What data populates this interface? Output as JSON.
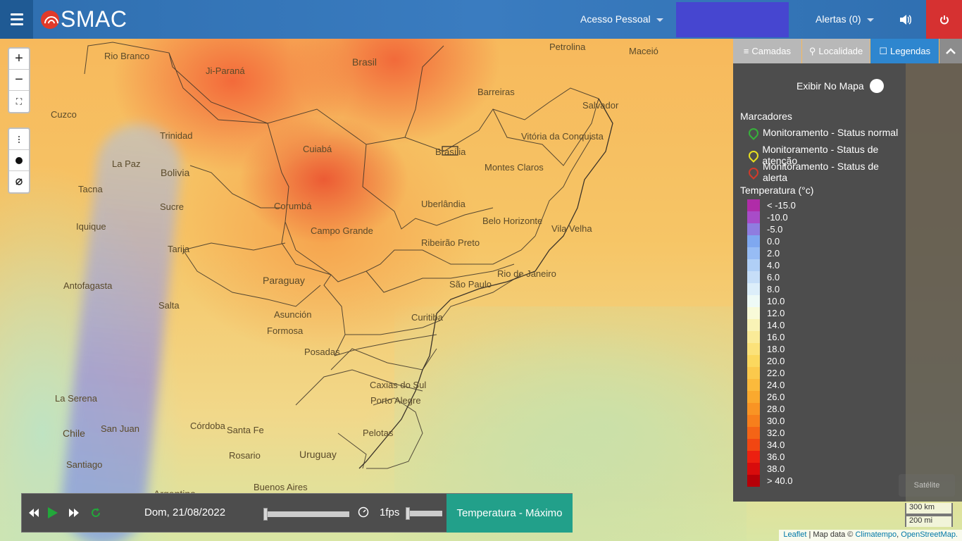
{
  "header": {
    "logo": "SMAC",
    "acesso": "Acesso Pessoal",
    "alertas": "Alertas (0)"
  },
  "map": {
    "labels": [
      {
        "text": "Rio Branco"
      },
      {
        "text": "Ji-Paraná"
      },
      {
        "text": "Brasil"
      },
      {
        "text": "Petrolina"
      },
      {
        "text": "Maceió"
      },
      {
        "text": "Barreiras"
      },
      {
        "text": "Salvador"
      },
      {
        "text": "Cuzco"
      },
      {
        "text": "Trinidad"
      },
      {
        "text": "Cuiabá"
      },
      {
        "text": "Brasília"
      },
      {
        "text": "Vitória da Conquista"
      },
      {
        "text": "La Paz"
      },
      {
        "text": "Bolivia"
      },
      {
        "text": "Montes Claros"
      },
      {
        "text": "Tacna"
      },
      {
        "text": "Sucre"
      },
      {
        "text": "Corumbá"
      },
      {
        "text": "Uberlândia"
      },
      {
        "text": "Iquique"
      },
      {
        "text": "Campo Grande"
      },
      {
        "text": "Belo Horizonte"
      },
      {
        "text": "Vila Velha"
      },
      {
        "text": "Tarija"
      },
      {
        "text": "Ribeirão Preto"
      },
      {
        "text": "Rio de Janeiro"
      },
      {
        "text": "Antofagasta"
      },
      {
        "text": "Paraguay"
      },
      {
        "text": "São Paulo"
      },
      {
        "text": "Salta"
      },
      {
        "text": "Asunción"
      },
      {
        "text": "Curitiba"
      },
      {
        "text": "Formosa"
      },
      {
        "text": "Posadas"
      },
      {
        "text": "Caxias do Sul"
      },
      {
        "text": "La Serena"
      },
      {
        "text": "Porto Alegre"
      },
      {
        "text": "Chile"
      },
      {
        "text": "San Juan"
      },
      {
        "text": "Córdoba"
      },
      {
        "text": "Santa Fe"
      },
      {
        "text": "Pelotas"
      },
      {
        "text": "Uruguay"
      },
      {
        "text": "Rosario"
      },
      {
        "text": "Santiago"
      },
      {
        "text": "Buenos Aires"
      },
      {
        "text": "Argentina"
      }
    ]
  },
  "zoom": {
    "in": "+",
    "out": "−",
    "fullscreen": "⛶"
  },
  "tabs": {
    "camadas": "Camadas",
    "localidade": "Localidade",
    "legendas": "Legendas"
  },
  "panel": {
    "exibir": "Exibir No Mapa",
    "marcadores_title": "Marcadores",
    "markers": [
      {
        "label": "Monitoramento - Status normal",
        "color": "#36b23a"
      },
      {
        "label": "Monitoramento - Status de atenção",
        "color": "#e8e020"
      },
      {
        "label": "Monitoramento - Status de alerta",
        "color": "#d23a2a"
      }
    ],
    "temp_title": "Temperatura (°c)",
    "legend": [
      {
        "label": "< -15.0",
        "color": "#b02ca8"
      },
      {
        "label": "-10.0",
        "color": "#a84cc8"
      },
      {
        "label": "-5.0",
        "color": "#8f7de0"
      },
      {
        "label": "0.0",
        "color": "#7fa8f0"
      },
      {
        "label": "2.0",
        "color": "#97bcf4"
      },
      {
        "label": "4.0",
        "color": "#b0cff6"
      },
      {
        "label": "6.0",
        "color": "#c6def8"
      },
      {
        "label": "8.0",
        "color": "#dceefa"
      },
      {
        "label": "10.0",
        "color": "#eefaf6"
      },
      {
        "label": "12.0",
        "color": "#f8fad8"
      },
      {
        "label": "14.0",
        "color": "#f9f3b6"
      },
      {
        "label": "16.0",
        "color": "#faeb98"
      },
      {
        "label": "18.0",
        "color": "#fbe27a"
      },
      {
        "label": "20.0",
        "color": "#fbd85e"
      },
      {
        "label": "22.0",
        "color": "#fbc94c"
      },
      {
        "label": "24.0",
        "color": "#fbba3c"
      },
      {
        "label": "26.0",
        "color": "#faa92e"
      },
      {
        "label": "28.0",
        "color": "#f99424"
      },
      {
        "label": "30.0",
        "color": "#f77f1c"
      },
      {
        "label": "32.0",
        "color": "#f46416"
      },
      {
        "label": "34.0",
        "color": "#f14612"
      },
      {
        "label": "36.0",
        "color": "#ec2010"
      },
      {
        "label": "38.0",
        "color": "#d80c0c"
      },
      {
        "label": "> 40.0",
        "color": "#b50008"
      }
    ]
  },
  "player": {
    "date": "Dom, 21/08/2022",
    "fps": "1fps",
    "variable": "Temperatura - Máximo"
  },
  "scale": {
    "km": "300 km",
    "mi": "200 mi"
  },
  "attribution": {
    "leaflet": "Leaflet",
    "mapdata": " | Map data © ",
    "climatempo": "Climatempo",
    "osm": "OpenStreetMap."
  },
  "satelite": "Satélite"
}
